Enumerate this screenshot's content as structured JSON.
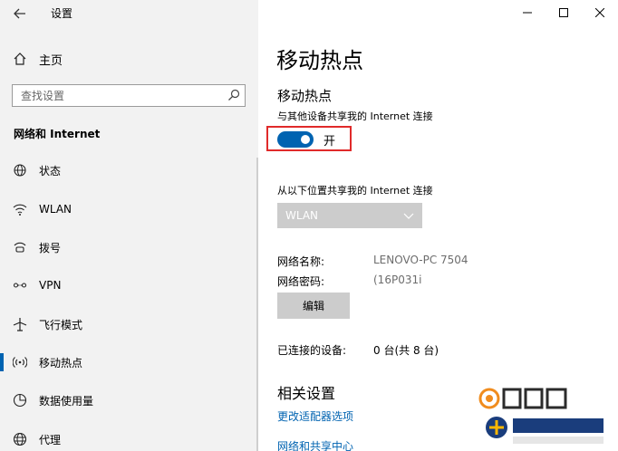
{
  "window": {
    "app_title": "设置",
    "controls": [
      "minimize-icon",
      "maximize-icon",
      "close-icon"
    ]
  },
  "sidebar": {
    "home_label": "主页",
    "search_placeholder": "查找设置",
    "section_heading": "网络和 Internet",
    "items": [
      {
        "label": "状态",
        "icon": "status-globe-icon"
      },
      {
        "label": "WLAN",
        "icon": "wifi-icon"
      },
      {
        "label": "拨号",
        "icon": "dialup-icon"
      },
      {
        "label": "VPN",
        "icon": "vpn-icon"
      },
      {
        "label": "飞行模式",
        "icon": "airplane-icon"
      },
      {
        "label": "移动热点",
        "icon": "hotspot-icon",
        "active": true
      },
      {
        "label": "数据使用量",
        "icon": "data-usage-icon"
      },
      {
        "label": "代理",
        "icon": "globe-icon"
      }
    ]
  },
  "main": {
    "page_title": "移动热点",
    "sub_title": "移动热点",
    "share_label": "与其他设备共享我的 Internet 连接",
    "toggle_state": "开",
    "from_label": "从以下位置共享我的 Internet 连接",
    "source_select": "WLAN",
    "network_name_label": "网络名称:",
    "network_name_value": "LENOVO-PC 7504",
    "network_password_label": "网络密码:",
    "network_password_value": "(16P031i",
    "edit_button": "编辑",
    "connected_label": "已连接的设备:",
    "connected_value": "0 台(共 8 台)",
    "related_heading": "相关设置",
    "links": [
      "更改适配器选项",
      "网络和共享中心"
    ]
  },
  "colors": {
    "accent": "#0063b1",
    "sidebar_bg": "#f2f2f2",
    "highlight_border": "#e02a2a"
  }
}
